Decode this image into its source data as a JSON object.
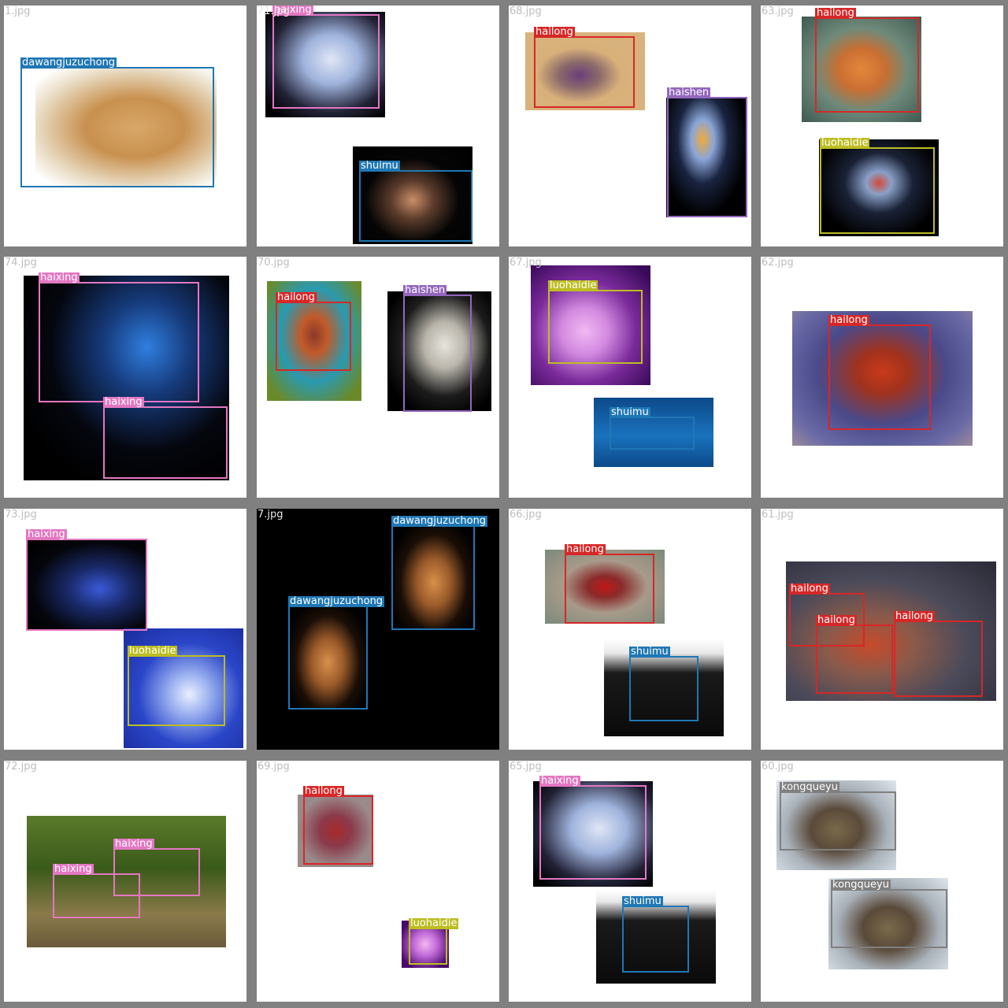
{
  "colors": {
    "haixing": "#e377c2",
    "shuimu": "#1f77b4",
    "hailong": "#d62728",
    "haishen": "#9467bd",
    "luohaidie": "#bcbd22",
    "dawangjuzuchong": "#1f77b4",
    "kongqueyu": "#7f7f7f"
  },
  "tiles": [
    {
      "filename": "1.jpg",
      "detections": [
        {
          "label": "dawangjuzuchong"
        }
      ]
    },
    {
      "filename": "71.jpg",
      "detections": [
        {
          "label": "haixing"
        },
        {
          "label": "shuimu"
        }
      ]
    },
    {
      "filename": "68.jpg",
      "detections": [
        {
          "label": "hailong"
        },
        {
          "label": "haishen"
        }
      ]
    },
    {
      "filename": "63.jpg",
      "detections": [
        {
          "label": "hailong"
        },
        {
          "label": "luohaidie"
        }
      ]
    },
    {
      "filename": "74.jpg",
      "detections": [
        {
          "label": "haixing"
        },
        {
          "label": "haixing"
        }
      ]
    },
    {
      "filename": "70.jpg",
      "detections": [
        {
          "label": "hailong"
        },
        {
          "label": "haishen"
        }
      ]
    },
    {
      "filename": "67.jpg",
      "detections": [
        {
          "label": "luohaidie"
        },
        {
          "label": "shuimu"
        }
      ]
    },
    {
      "filename": "62.jpg",
      "detections": [
        {
          "label": "hailong"
        }
      ]
    },
    {
      "filename": "73.jpg",
      "detections": [
        {
          "label": "haixing"
        },
        {
          "label": "luohaidie"
        }
      ]
    },
    {
      "filename": "7.jpg",
      "detections": [
        {
          "label": "dawangjuzuchong"
        },
        {
          "label": "dawangjuzuchong"
        }
      ]
    },
    {
      "filename": "66.jpg",
      "detections": [
        {
          "label": "hailong"
        },
        {
          "label": "shuimu"
        }
      ]
    },
    {
      "filename": "61.jpg",
      "detections": [
        {
          "label": "hailong"
        },
        {
          "label": "hailong"
        },
        {
          "label": "hailong"
        }
      ]
    },
    {
      "filename": "72.jpg",
      "detections": [
        {
          "label": "haixing"
        },
        {
          "label": "haixing"
        }
      ]
    },
    {
      "filename": "69.jpg",
      "detections": [
        {
          "label": "hailong"
        },
        {
          "label": "luohaidie"
        }
      ]
    },
    {
      "filename": "65.jpg",
      "detections": [
        {
          "label": "haixing"
        },
        {
          "label": "shuimu"
        }
      ]
    },
    {
      "filename": "60.jpg",
      "detections": [
        {
          "label": "kongqueyu"
        },
        {
          "label": "kongqueyu"
        }
      ]
    }
  ]
}
